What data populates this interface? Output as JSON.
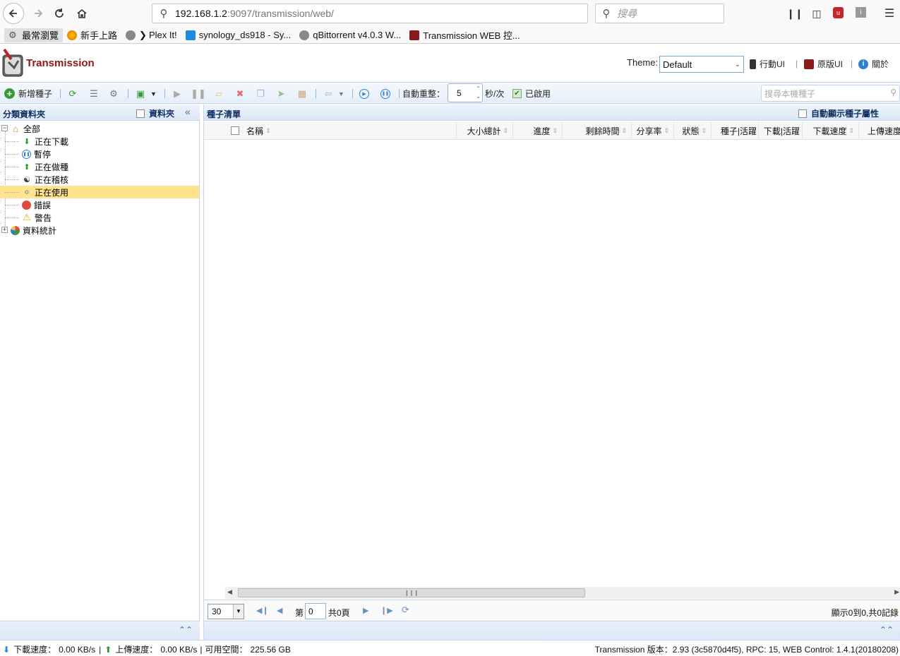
{
  "browser": {
    "url_host": "192.168.1.2",
    "url_rest": ":9097/transmission/web/",
    "search_placeholder": "搜尋",
    "bookmarks": [
      {
        "label": "最常瀏覽",
        "icon": "gear-icon",
        "color": "#555555"
      },
      {
        "label": "新手上路",
        "icon": "firefox-icon",
        "color": "#e66000"
      },
      {
        "label": "Plex It!",
        "icon": "globe-icon",
        "color": "#777777"
      },
      {
        "label": "synology_ds918 - Sy...",
        "icon": "dsm-icon",
        "color": "#1e88e5"
      },
      {
        "label": "qBittorrent v4.0.3 W...",
        "icon": "globe-icon",
        "color": "#777777"
      },
      {
        "label": "Transmission WEB 控...",
        "icon": "transmission-icon",
        "color": "#8b1a1a"
      }
    ]
  },
  "header": {
    "app_title": "Transmission",
    "theme_label": "Theme:",
    "theme_value": "Default",
    "links": {
      "mobile_ui": "行動UI",
      "original_ui": "原版UI",
      "about": "關於"
    }
  },
  "toolbar": {
    "add_torrent": "新增種子",
    "auto_refresh_label": "自動重整：",
    "refresh_value": "5",
    "refresh_unit": "秒/次",
    "enabled_label": "已啟用",
    "search_placeholder": "搜尋本機種子"
  },
  "left_panel": {
    "title": "分類資料夾",
    "folder_checkbox": "資料夾",
    "tree": {
      "all": "全部",
      "children": [
        {
          "label": "正在下載",
          "icon": "download-arrow-icon",
          "selected": false
        },
        {
          "label": "暫停",
          "icon": "pause-icon",
          "selected": false
        },
        {
          "label": "正在做種",
          "icon": "upload-arrow-icon",
          "selected": false
        },
        {
          "label": "正在稽核",
          "icon": "checking-icon",
          "selected": false
        },
        {
          "label": "正在使用",
          "icon": "active-icon",
          "selected": true
        },
        {
          "label": "錯誤",
          "icon": "error-icon",
          "selected": false
        },
        {
          "label": "警告",
          "icon": "warning-icon",
          "selected": false
        }
      ],
      "stats": "資料統計"
    }
  },
  "right_panel": {
    "title": "種子清單",
    "auto_show": "自動顯示種子屬性",
    "columns": [
      "名稱",
      "大小總計",
      "進度",
      "剩餘時間",
      "分享率",
      "狀態",
      "種子|活躍",
      "下載|活躍",
      "下載速度",
      "上傳速度"
    ]
  },
  "pager": {
    "page_size": "30",
    "page_prefix": "第",
    "page_value": "0",
    "page_total": "共0頁",
    "records_info": "顯示0到0,共0記錄"
  },
  "statusbar": {
    "download_label": "下載速度：",
    "download_value": "0.00 KB/s",
    "upload_label": "上傳速度：",
    "upload_value": "0.00 KB/s",
    "free_space_label": "可用空間：",
    "free_space_value": "225.56 GB",
    "version_info": "Transmission 版本：2.93 (3c5870d4f5), RPC: 15, WEB Control: 1.4.1(20180208)"
  },
  "colors": {
    "brand": "#8b1a1a",
    "panel_head": "#dbe7f5",
    "selected_row": "#ffe38e",
    "link_blue": "#0e2d5f"
  }
}
